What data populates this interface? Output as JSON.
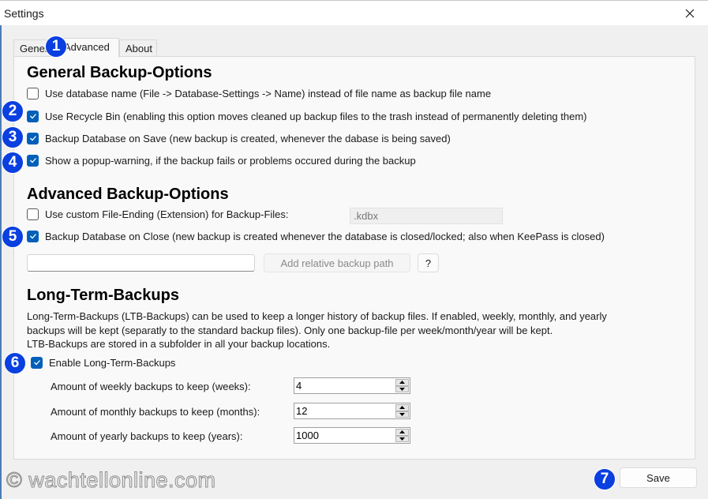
{
  "window": {
    "title": "Settings",
    "close_icon": "close-icon"
  },
  "tabs": [
    {
      "label": "General",
      "active": false
    },
    {
      "label": "Advanced",
      "active": true
    },
    {
      "label": "About",
      "active": false
    }
  ],
  "general": {
    "heading": "General Backup-Options",
    "options": [
      {
        "label": "Use database name (File -> Database-Settings -> Name) instead of file name as backup file name",
        "checked": false
      },
      {
        "label": "Use Recycle Bin (enabling this option moves cleaned up backup files to the trash instead of permanently deleting them)",
        "checked": true
      },
      {
        "label": "Backup Database on Save (new backup is created, whenever the dabase is being saved)",
        "checked": true
      },
      {
        "label": "Show a popup-warning, if the backup fails or problems occured during the backup",
        "checked": true
      }
    ]
  },
  "advanced": {
    "heading": "Advanced Backup-Options",
    "custom_ext": {
      "label": "Use custom File-Ending (Extension) for Backup-Files:",
      "checked": false,
      "value": ".kdbx"
    },
    "on_close": {
      "label": "Backup Database on Close (new backup is created whenever the database is closed/locked; also when KeePass is closed)",
      "checked": true
    },
    "path_input_value": "",
    "add_path_label": "Add relative backup path",
    "help_label": "?"
  },
  "ltb": {
    "heading": "Long-Term-Backups",
    "description": [
      "Long-Term-Backups (LTB-Backups) can be used to keep a longer history of backup files. If enabled, weekly, monthly, and yearly",
      "backups will be kept (separatly to the standard backup files). Only one backup-file per week/month/year will be kept.",
      "LTB-Backups are stored in a subfolder in all your backup locations."
    ],
    "enable": {
      "label": "Enable Long-Term-Backups",
      "checked": true
    },
    "fields": [
      {
        "label": "Amount of weekly backups to keep (weeks):",
        "value": "4"
      },
      {
        "label": "Amount of monthly backups to keep (months):",
        "value": "12"
      },
      {
        "label": "Amount of yearly backups to keep (years):",
        "value": "1000"
      }
    ]
  },
  "footer": {
    "save_label": "Save",
    "watermark": "© wachtellonline.com"
  },
  "annotations": [
    "1",
    "2",
    "3",
    "4",
    "5",
    "6",
    "7"
  ],
  "colors": {
    "accent": "#005fb8",
    "badge": "#0a3fe0"
  }
}
